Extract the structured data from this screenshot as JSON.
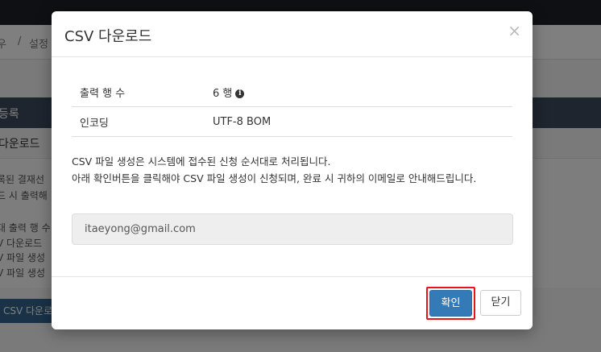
{
  "background": {
    "breadcrumb": {
      "item1": "우",
      "separator": "/",
      "item2": "설정"
    },
    "section_title": "등록",
    "sub_title": "다운로드",
    "panel_lines": [
      "록된 결재선",
      "드 시 출력해",
      "대 출력 행 수",
      "V 다운로드",
      "V 파일 생성",
      "V 파일 생성"
    ],
    "csv_button": "CSV 다운로"
  },
  "modal": {
    "title": "CSV 다운로드",
    "close_symbol": "×",
    "rows": [
      {
        "label": "출력 행 수",
        "value": "6 행",
        "has_info_icon": true
      },
      {
        "label": "인코딩",
        "value": "UTF-8 BOM",
        "has_info_icon": false
      }
    ],
    "info_icon_glyph": "i",
    "notice_line1": "CSV 파일 생성은 시스템에 접수된 신청 순서대로 처리됩니다.",
    "notice_line2": "아래 확인버튼을 클릭해야 CSV 파일 생성이 신청되며, 완료 시 귀하의 이메일로 안내해드립니다.",
    "email": "itaeyong@gmail.com",
    "confirm_label": "확인",
    "close_label": "닫기",
    "colors": {
      "primary": "#337ab7",
      "highlight": "#e8141c"
    }
  }
}
